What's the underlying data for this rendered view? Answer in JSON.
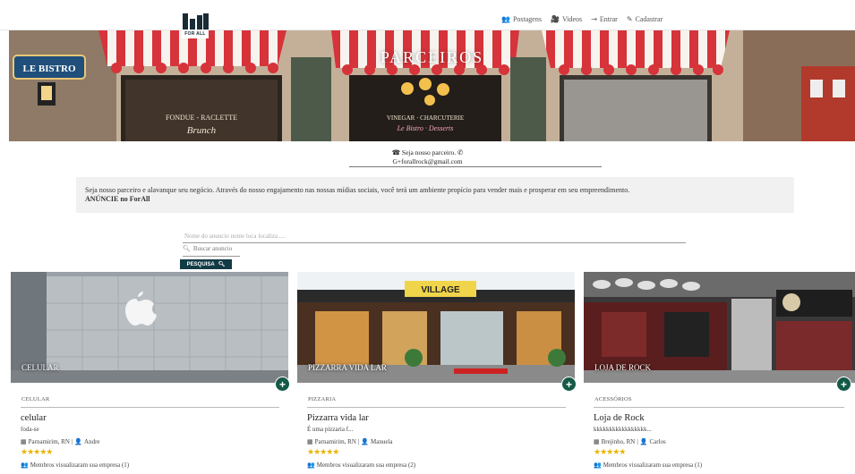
{
  "logo": {
    "text": "FOR ALL"
  },
  "nav": [
    {
      "icon": "group-icon",
      "glyph": "👥",
      "label": "Postagens"
    },
    {
      "icon": "video-icon",
      "glyph": "🎥",
      "label": "Videos"
    },
    {
      "icon": "login-icon",
      "glyph": "⇥",
      "label": "Entrar"
    },
    {
      "icon": "edit-icon",
      "glyph": "✎",
      "label": "Cadastrar"
    }
  ],
  "banner": {
    "title": "PARCEIROS"
  },
  "contact": {
    "line1": "Seja nosso parceiro.",
    "line2": "G+forallrock@gmail.com"
  },
  "intro": {
    "text": "Seja nosso parceiro e alavanque seu negócio. Através do nosso engajamento nas nossas mídias sociais, você terá um ambiente propício para vender mais e prosperar em seu empreendimento.",
    "cta": "ANÚNCIE no ForAll"
  },
  "search": {
    "placeholder": "Nome do anuncio nome loca localiza ....",
    "input_placeholder": "Buscar anuncio",
    "button_label": "PESQUISA"
  },
  "cards": [
    {
      "overlay": "CELULAR",
      "category": "CELULAR",
      "name": "celular",
      "desc": "foda-se",
      "location": "Parnamirim, RN",
      "owner": "Andre",
      "stars": "★★★★★",
      "views": "Membros visualizaram sua empresa (1)"
    },
    {
      "overlay": "PIZZARRA VIDA LAR",
      "category": "PIZZARIA",
      "name": "Pizzarra vida lar",
      "desc": "É uma pizzaria f...",
      "location": "Parnamirim, RN",
      "owner": "Manuela",
      "stars": "★★★★★",
      "views": "Membros visualizaram sua empresa (2)"
    },
    {
      "overlay": "LOJA DE ROCK",
      "category": "ACESSÓRIOS",
      "name": "Loja de Rock",
      "desc": "kkkkkkkkkkkkkkkkk...",
      "location": "Brejinho, RN",
      "owner": "Carlos",
      "stars": "★★★★★",
      "views": "Membros visualizaram sua empresa (1)"
    }
  ],
  "colors": {
    "button": "#123b45",
    "add_button": "#145a47",
    "stars": "#e7b400"
  }
}
